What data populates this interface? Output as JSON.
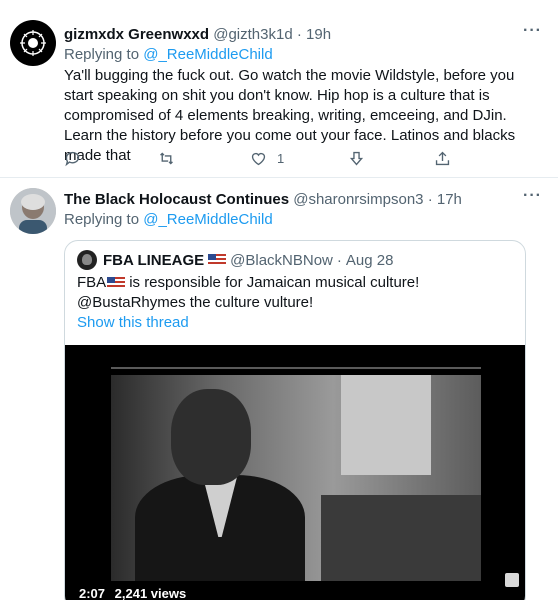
{
  "tweets": [
    {
      "author_name": "gizmxdx Greenwxxd",
      "handle": "@gizth3k1d",
      "separator": "·",
      "time": "19h",
      "replying_label": "Replying to",
      "replying_to": "@_ReeMiddleChild",
      "text": "Ya'll bugging the fuck out. Go watch the movie Wildstyle, before you start speaking on shit you don't know. Hip hop is a culture that is compromised of 4 elements breaking, writing, emceeing, and DJin. Learn the history before you come out your face. Latinos and blacks made that",
      "like_count": "1",
      "more_icon": "···"
    },
    {
      "author_name": "The Black Holocaust Continues",
      "handle": "@sharonrsimpson3",
      "separator": "·",
      "time": "17h",
      "replying_label": "Replying to",
      "replying_to": "@_ReeMiddleChild",
      "more_icon": "···",
      "quote": {
        "author_name": "FBA LINEAGE",
        "handle": "@BlackNBNow",
        "separator": "·",
        "time": "Aug 28",
        "text_prefix": "FBA",
        "text": "is responsible for Jamaican musical culture! @BustaRhymes the culture vulture!",
        "show_thread": "Show this thread",
        "video": {
          "duration": "2:07",
          "views": "2,241 views"
        }
      }
    }
  ],
  "colors": {
    "link": "#1d9bf0",
    "secondary_text": "#536471",
    "primary_text": "#0f1419",
    "border": "#cfd9de"
  }
}
